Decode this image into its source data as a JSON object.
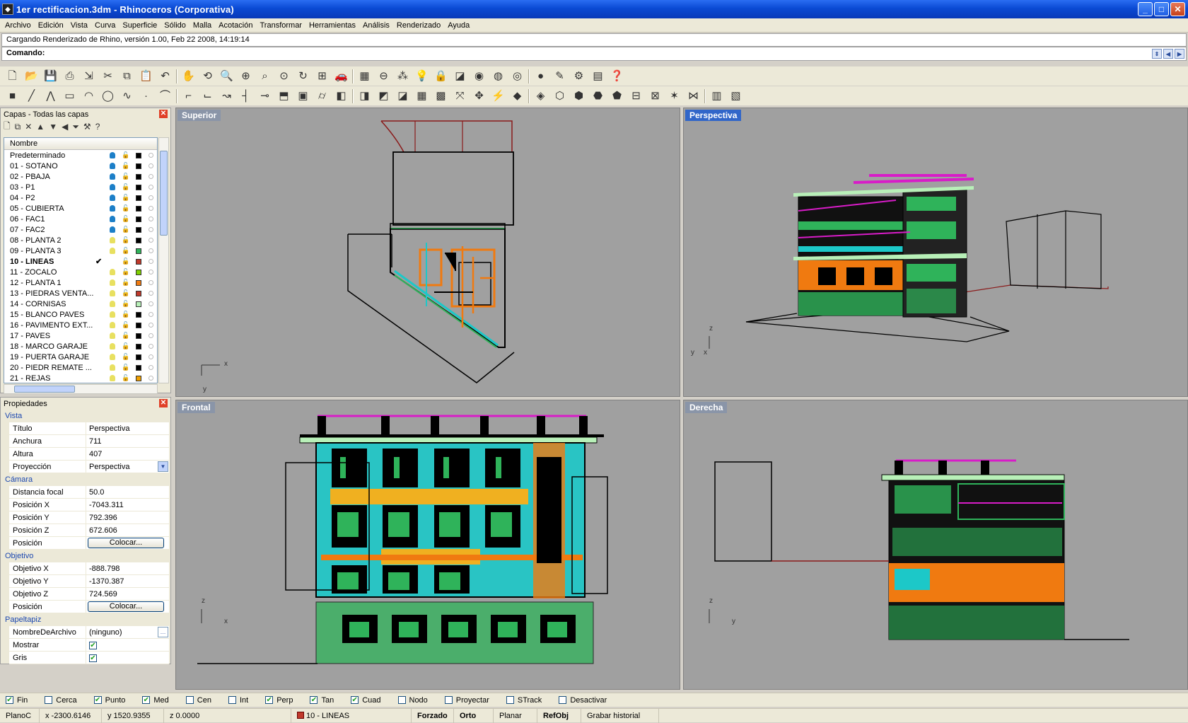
{
  "window": {
    "title": "1er rectificacion.3dm - Rhinoceros (Corporativa)",
    "buttons": [
      "_",
      "□",
      "✕"
    ]
  },
  "menu": [
    "Archivo",
    "Edición",
    "Vista",
    "Curva",
    "Superficie",
    "Sólido",
    "Malla",
    "Acotación",
    "Transformar",
    "Herramientas",
    "Análisis",
    "Renderizado",
    "Ayuda"
  ],
  "command": {
    "history": "Cargando Renderizado de Rhino, versión 1.00, Feb 22 2008, 14:19:14",
    "prompt": "Comando:"
  },
  "toolbar1_icons": [
    "new-file",
    "open-file",
    "save",
    "print",
    "import",
    "cut",
    "copy",
    "paste",
    "undo",
    "pan-hand",
    "rotate-view",
    "zoom-dynamic",
    "zoom-window",
    "zoom-extents",
    "zoom-selected",
    "zoom-realtime",
    "four-viewports",
    "car-render",
    "grid",
    "options-circle",
    "select-points",
    "light-bulb",
    "lock",
    "layer",
    "color-wheel",
    "sphere-wire",
    "shaded-sphere",
    "render-sphere",
    "pencil-tri",
    "gear-settings",
    "properties-grid",
    "help"
  ],
  "toolbar2_icons": [
    "save-red",
    "line",
    "polyline",
    "rectangle",
    "arc",
    "circle",
    "curve",
    "point",
    "curve-b",
    "curve-c",
    "curve-d",
    "curve-e",
    "trim-line",
    "split",
    "extrude",
    "box",
    "cylinder",
    "surface-a",
    "surface-b",
    "boolean-a",
    "boolean-b",
    "mesh-a",
    "mesh-b",
    "transform",
    "move-gear",
    "analyze",
    "solid-a",
    "solid-b",
    "solid-c",
    "solid-d",
    "solid-e",
    "solid-f",
    "grid-b",
    "array",
    "explode",
    "join",
    "render-a",
    "render-b"
  ],
  "layers": {
    "panel_title": "Capas - Todas las capas",
    "column_header": "Nombre",
    "tool_icons": [
      "new-layer",
      "new-sublayer",
      "delete-layer",
      "move-up",
      "move-down",
      "move-left",
      "filter",
      "tools",
      "help"
    ],
    "rows": [
      {
        "name": "Predeterminado",
        "bulb": "#1c7fc8",
        "color": "#000000",
        "current": false
      },
      {
        "name": "01 - SOTANO",
        "bulb": "#1c7fc8",
        "color": "#000000",
        "current": false
      },
      {
        "name": "02 - PBAJA",
        "bulb": "#1c7fc8",
        "color": "#000000",
        "current": false
      },
      {
        "name": "03 - P1",
        "bulb": "#1c7fc8",
        "color": "#000000",
        "current": false
      },
      {
        "name": "04 - P2",
        "bulb": "#1c7fc8",
        "color": "#000000",
        "current": false
      },
      {
        "name": "05 - CUBIERTA",
        "bulb": "#1c7fc8",
        "color": "#000000",
        "current": false
      },
      {
        "name": "06 - FAC1",
        "bulb": "#1c7fc8",
        "color": "#000000",
        "current": false
      },
      {
        "name": "07 - FAC2",
        "bulb": "#1c7fc8",
        "color": "#000000",
        "current": false
      },
      {
        "name": "08 - PLANTA 2",
        "bulb": "#e8e060",
        "color": "#000000",
        "current": false
      },
      {
        "name": "09 - PLANTA 3",
        "bulb": "#e8e060",
        "color": "#2fb35a",
        "current": false
      },
      {
        "name": "10 - LINEAS",
        "bulb": "#ffffff",
        "color": "#c0392b",
        "current": true
      },
      {
        "name": "11 - ZOCALO",
        "bulb": "#e8e060",
        "color": "#7fd000",
        "current": false
      },
      {
        "name": "12 - PLANTA 1",
        "bulb": "#e8e060",
        "color": "#f07a10",
        "current": false
      },
      {
        "name": "13 - PIEDRAS VENTA...",
        "bulb": "#e8e060",
        "color": "#c0392b",
        "current": false
      },
      {
        "name": "14 - CORNISAS",
        "bulb": "#e8e060",
        "color": "#b8f0b8",
        "current": false
      },
      {
        "name": "15 - BLANCO PAVES",
        "bulb": "#e8e060",
        "color": "#000000",
        "current": false
      },
      {
        "name": "16 - PAVIMENTO EXT...",
        "bulb": "#e8e060",
        "color": "#000000",
        "current": false
      },
      {
        "name": "17 - PAVES",
        "bulb": "#e8e060",
        "color": "#000000",
        "current": false
      },
      {
        "name": "18 - MARCO GARAJE",
        "bulb": "#e8e060",
        "color": "#000000",
        "current": false
      },
      {
        "name": "19 - PUERTA GARAJE",
        "bulb": "#e8e060",
        "color": "#000000",
        "current": false
      },
      {
        "name": "20 - PIEDR REMATE ...",
        "bulb": "#e8e060",
        "color": "#000000",
        "current": false
      },
      {
        "name": "21 - REJAS",
        "bulb": "#e8e060",
        "color": "#f0a000",
        "current": false
      }
    ]
  },
  "properties": {
    "panel_title": "Propiedades",
    "sections": [
      {
        "title": "Vista",
        "rows": [
          {
            "key": "Título",
            "value": "Perspectiva",
            "type": "text"
          },
          {
            "key": "Anchura",
            "value": "711",
            "type": "text"
          },
          {
            "key": "Altura",
            "value": "407",
            "type": "text"
          },
          {
            "key": "Proyección",
            "value": "Perspectiva",
            "type": "dropdown"
          }
        ]
      },
      {
        "title": "Cámara",
        "rows": [
          {
            "key": "Distancia focal",
            "value": "50.0",
            "type": "text"
          },
          {
            "key": "Posición X",
            "value": "-7043.311",
            "type": "text"
          },
          {
            "key": "Posición Y",
            "value": "792.396",
            "type": "text"
          },
          {
            "key": "Posición Z",
            "value": "672.606",
            "type": "text"
          },
          {
            "key": "Posición",
            "value": "Colocar...",
            "type": "button"
          }
        ]
      },
      {
        "title": "Objetivo",
        "rows": [
          {
            "key": "Objetivo X",
            "value": "-888.798",
            "type": "text"
          },
          {
            "key": "Objetivo Y",
            "value": "-1370.387",
            "type": "text"
          },
          {
            "key": "Objetivo Z",
            "value": "724.569",
            "type": "text"
          },
          {
            "key": "Posición",
            "value": "Colocar...",
            "type": "button"
          }
        ]
      },
      {
        "title": "Papeltapiz",
        "rows": [
          {
            "key": "NombreDeArchivo",
            "value": "(ninguno)",
            "type": "file"
          },
          {
            "key": "Mostrar",
            "value": "✔",
            "type": "check"
          },
          {
            "key": "Gris",
            "value": "✔",
            "type": "check"
          }
        ]
      }
    ]
  },
  "viewports": {
    "top": {
      "label": "Superior",
      "axes": [
        "x",
        "y"
      ]
    },
    "perspective": {
      "label": "Perspectiva",
      "axes": [
        "z",
        "y",
        "x"
      ]
    },
    "front": {
      "label": "Frontal",
      "axes": [
        "z",
        "x"
      ]
    },
    "right": {
      "label": "Derecha",
      "axes": [
        "z",
        "y"
      ]
    }
  },
  "osnaps": [
    {
      "label": "Fin",
      "checked": true
    },
    {
      "label": "Cerca",
      "checked": false
    },
    {
      "label": "Punto",
      "checked": true
    },
    {
      "label": "Med",
      "checked": true
    },
    {
      "label": "Cen",
      "checked": false
    },
    {
      "label": "Int",
      "checked": false
    },
    {
      "label": "Perp",
      "checked": true
    },
    {
      "label": "Tan",
      "checked": true
    },
    {
      "label": "Cuad",
      "checked": true
    },
    {
      "label": "Nodo",
      "checked": false
    },
    {
      "label": "Proyectar",
      "checked": false
    },
    {
      "label": "STrack",
      "checked": false
    },
    {
      "label": "Desactivar",
      "checked": false
    }
  ],
  "status": {
    "cplane": "PlanoC",
    "x": "x -2300.6146",
    "y": "y 1520.9355",
    "z": "z 0.0000",
    "layer": "10 - LINEAS",
    "layer_color": "#c0392b",
    "forzado": "Forzado",
    "orto": "Orto",
    "planar": "Planar",
    "refobj": "RefObj",
    "history": "Grabar historial"
  }
}
